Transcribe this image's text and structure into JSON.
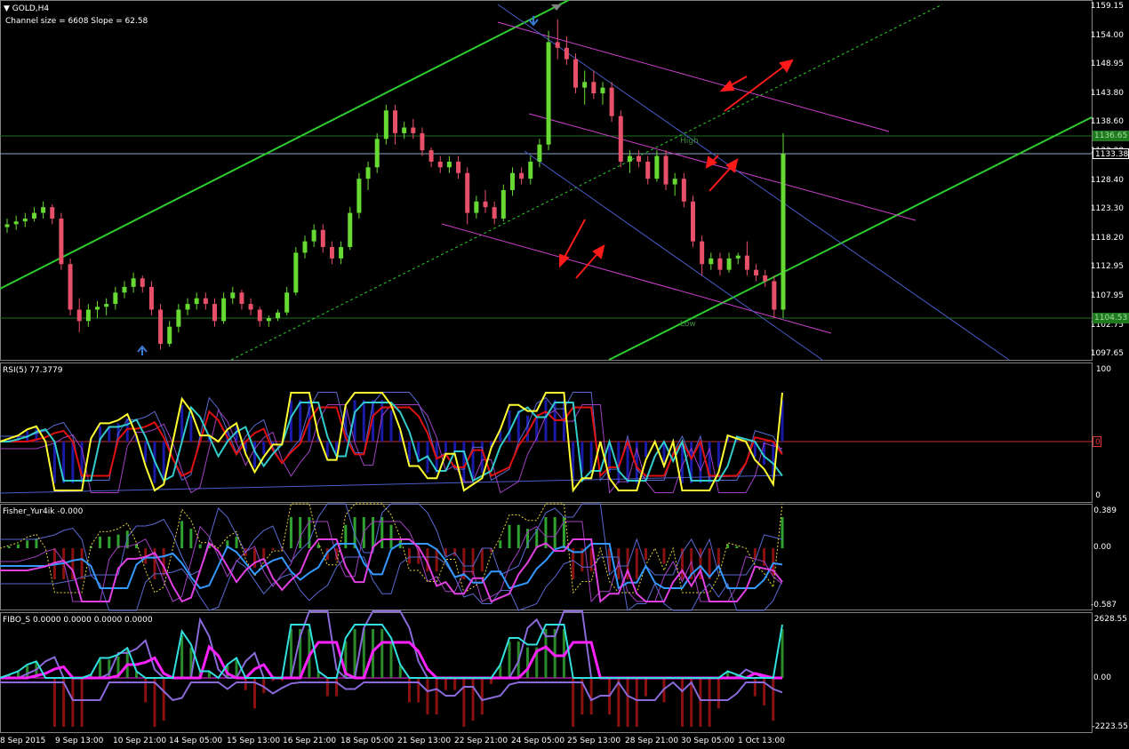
{
  "window": {
    "symbol_title": "GOLD,H4",
    "channel_info": "Channel size = 6608 Slope = 62.58"
  },
  "panes": {
    "rsi": {
      "label": "RSI(5) 77.3779",
      "ticks": [
        "100",
        "0"
      ],
      "level_tag": "0"
    },
    "fisher": {
      "label": "Fisher_Yur4ik -0.000",
      "ticks": [
        "0.389",
        "0.00",
        "-0.587"
      ]
    },
    "fibo": {
      "label": "FIBO_S 0.0000 0.0000 0.0000 0.0000",
      "ticks": [
        "2628.55",
        "0.00",
        "-2223.55"
      ]
    }
  },
  "price_axis": [
    "1159.15",
    "1154.00",
    "1148.95",
    "1143.80",
    "1138.60",
    "1133.38",
    "1128.40",
    "1123.30",
    "1118.20",
    "1112.95",
    "1107.95",
    "1102.75",
    "1097.65"
  ],
  "price_tags": {
    "high": "1136.65",
    "current": "1133.38",
    "low": "1104.53"
  },
  "chart_labels": {
    "high": "High",
    "low": "Low"
  },
  "time_axis": [
    "8 Sep 2015",
    "9 Sep 13:00",
    "10 Sep 21:00",
    "14 Sep 05:00",
    "15 Sep 13:00",
    "16 Sep 21:00",
    "18 Sep 05:00",
    "21 Sep 13:00",
    "22 Sep 21:00",
    "24 Sep 05:00",
    "25 Sep 13:00",
    "28 Sep 21:00",
    "30 Sep 05:00",
    "1 Oct 13:00"
  ],
  "colors": {
    "bull": "#66d933",
    "bear": "#e8506a",
    "channel": "#2ecc2e",
    "channel_mid": "#2ecc2e",
    "magenta": "#d040d0",
    "blue_line": "#4a5cc8",
    "arrow": "#ff1a1a",
    "rsi": "#ffff33",
    "rsi_red": "#e01010",
    "rsi_cyan": "#33cccc",
    "rsi_hist": "#1a1aa8",
    "fisher_hist_pos": "#2fa32f",
    "fisher_hist_neg": "#8b1010",
    "fisher_magenta": "#e040e0",
    "fisher_blue": "#3399ff",
    "fibo_hist_pos": "#2a8a2a",
    "fibo_hist_neg": "#8b1010",
    "fibo_magenta": "#ff22ff",
    "fibo_cyan": "#33e0e0",
    "fibo_violet": "#8a6ad8"
  },
  "chart_data": {
    "type": "candlestick",
    "symbol": "GOLD",
    "timeframe": "H4",
    "y_range": [
      1097.65,
      1159.15
    ],
    "candles": [
      [
        1120.5,
        1122,
        1119.5,
        1121
      ],
      [
        1121,
        1122.5,
        1120,
        1121.5
      ],
      [
        1121.5,
        1123,
        1120.5,
        1122
      ],
      [
        1122,
        1124,
        1121.5,
        1123
      ],
      [
        1123,
        1125,
        1122,
        1124
      ],
      [
        1124,
        1124.5,
        1121,
        1122
      ],
      [
        1122,
        1123,
        1113,
        1114
      ],
      [
        1114,
        1115,
        1105,
        1106
      ],
      [
        1106,
        1108,
        1102,
        1104
      ],
      [
        1104,
        1107,
        1103,
        1106
      ],
      [
        1106,
        1107.5,
        1104.5,
        1106.5
      ],
      [
        1106.5,
        1108,
        1105,
        1107
      ],
      [
        1107,
        1110,
        1106,
        1109
      ],
      [
        1109,
        1111,
        1108,
        1110
      ],
      [
        1110,
        1112.5,
        1109,
        1111.5
      ],
      [
        1111.5,
        1112,
        1109,
        1110
      ],
      [
        1110,
        1111,
        1105,
        1106
      ],
      [
        1106,
        1107,
        1099,
        1100
      ],
      [
        1100,
        1104,
        1099.5,
        1103
      ],
      [
        1103,
        1107,
        1102,
        1106
      ],
      [
        1106,
        1108,
        1105,
        1107
      ],
      [
        1107,
        1109,
        1106,
        1108
      ],
      [
        1108,
        1109,
        1106,
        1107
      ],
      [
        1107,
        1108,
        1103,
        1104
      ],
      [
        1104,
        1109,
        1103.5,
        1108
      ],
      [
        1108,
        1110,
        1107,
        1109
      ],
      [
        1109,
        1109.5,
        1106,
        1107
      ],
      [
        1107,
        1108,
        1105,
        1106
      ],
      [
        1106,
        1106.5,
        1103,
        1104
      ],
      [
        1104,
        1105,
        1103,
        1104.5
      ],
      [
        1104.5,
        1106,
        1104,
        1105.5
      ],
      [
        1105.5,
        1110,
        1105,
        1109
      ],
      [
        1109,
        1117,
        1108.5,
        1116
      ],
      [
        1116,
        1119,
        1115,
        1118
      ],
      [
        1118,
        1121,
        1117,
        1120
      ],
      [
        1120,
        1121,
        1116,
        1117
      ],
      [
        1117,
        1118,
        1114,
        1115
      ],
      [
        1115,
        1118,
        1114,
        1117
      ],
      [
        1117,
        1124,
        1116.5,
        1123
      ],
      [
        1123,
        1130,
        1122,
        1129
      ],
      [
        1129,
        1132,
        1127,
        1131
      ],
      [
        1131,
        1137,
        1130,
        1136
      ],
      [
        1136,
        1142,
        1135,
        1141
      ],
      [
        1141,
        1142,
        1135,
        1137
      ],
      [
        1137,
        1139,
        1136,
        1138
      ],
      [
        1138,
        1139.5,
        1136,
        1137
      ],
      [
        1137,
        1138,
        1133,
        1134
      ],
      [
        1134,
        1134.5,
        1131,
        1132
      ],
      [
        1132,
        1133,
        1130,
        1131
      ],
      [
        1131,
        1133,
        1130,
        1132
      ],
      [
        1132,
        1133,
        1129,
        1130
      ],
      [
        1130,
        1131,
        1121,
        1123
      ],
      [
        1123,
        1126,
        1122,
        1125
      ],
      [
        1125,
        1127,
        1123,
        1124
      ],
      [
        1124,
        1125,
        1121,
        1122
      ],
      [
        1122,
        1128,
        1121.5,
        1127
      ],
      [
        1127,
        1131,
        1126,
        1130
      ],
      [
        1130,
        1131,
        1128,
        1129
      ],
      [
        1129,
        1133,
        1128,
        1132
      ],
      [
        1132,
        1136,
        1131,
        1135
      ],
      [
        1135,
        1155,
        1134,
        1153
      ],
      [
        1153,
        1157,
        1150,
        1152
      ],
      [
        1152,
        1154,
        1149,
        1150
      ],
      [
        1150,
        1151,
        1144,
        1145
      ],
      [
        1145,
        1148,
        1142,
        1146
      ],
      [
        1146,
        1148,
        1143,
        1144
      ],
      [
        1144,
        1146,
        1142,
        1145
      ],
      [
        1145,
        1146,
        1139,
        1140
      ],
      [
        1140,
        1141,
        1131,
        1132
      ],
      [
        1132,
        1134,
        1130,
        1133
      ],
      [
        1133,
        1134,
        1131,
        1132
      ],
      [
        1132,
        1133,
        1128,
        1129
      ],
      [
        1129,
        1134,
        1128.5,
        1133
      ],
      [
        1133,
        1134,
        1127,
        1128
      ],
      [
        1128,
        1130,
        1126,
        1129
      ],
      [
        1129,
        1130,
        1124,
        1125
      ],
      [
        1125,
        1126,
        1117,
        1118
      ],
      [
        1118,
        1119,
        1112,
        1114
      ],
      [
        1114,
        1116,
        1113,
        1115
      ],
      [
        1115,
        1116,
        1112,
        1113
      ],
      [
        1113,
        1116,
        1112.5,
        1115
      ],
      [
        1115,
        1116,
        1114,
        1115.5
      ],
      [
        1115.5,
        1118,
        1112,
        1113
      ],
      [
        1113,
        1114,
        1111,
        1112
      ],
      [
        1112,
        1113,
        1110,
        1111
      ],
      [
        1111,
        1112,
        1104.5,
        1106
      ],
      [
        1106,
        1137,
        1104.5,
        1133.38
      ]
    ]
  }
}
